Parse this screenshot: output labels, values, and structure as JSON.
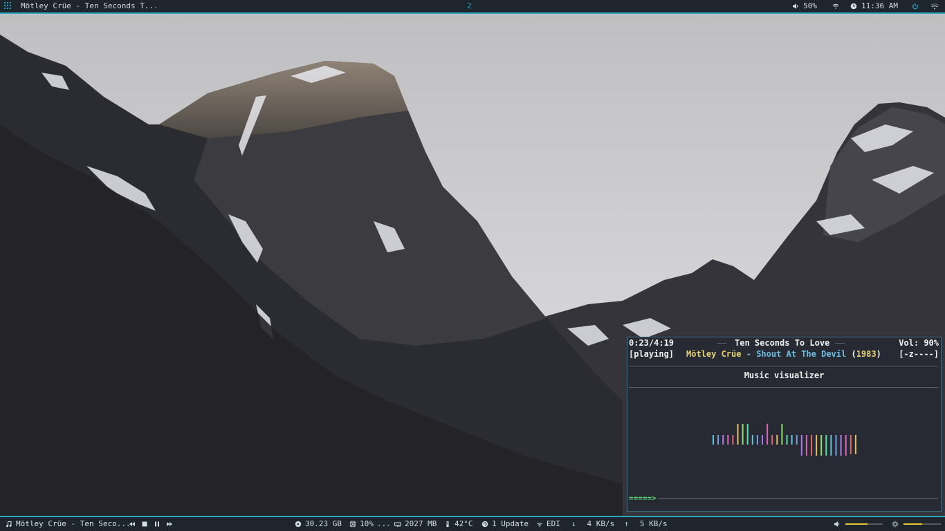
{
  "topbar": {
    "window_title": "Mötley Crüe - Ten Seconds T...",
    "workspace": "2",
    "volume": "50%",
    "time": "11:36 AM",
    "accent": "#2aa7c1",
    "icons": [
      "apps-grid-icon",
      "speaker-icon",
      "wifi-icon",
      "clock-icon",
      "power-icon",
      "wifi-signal-icon"
    ]
  },
  "player": {
    "elapsed_total": "0:23/4:19",
    "status": "[playing]",
    "title": "Ten Seconds To Love",
    "artist": "Mötley Crüe",
    "separator": "-",
    "album": "Shout At The Devil",
    "year_open": "(",
    "year": "1983",
    "year_close": ")",
    "volume": "Vol: 90%",
    "flags": "[-z----]",
    "screen_title": "Music visualizer",
    "progress_text": "=====>"
  },
  "bottombar": {
    "now_playing": "Mötley Crüe - Ten Seco...",
    "disk": "30.23 GB",
    "cpu": "10%",
    "cpu_more": "...",
    "memory": "2027 MB",
    "temperature": "42°C",
    "updates": "1 Update",
    "network_name": "EDI",
    "down_arrow": "↓",
    "download": "4 KB/s",
    "up_arrow": "↑",
    "upload": "5 KB/s",
    "volume_level": 0.6,
    "brightness_level": 0.5,
    "icons": [
      "music-note-icon",
      "previous-icon",
      "stop-icon",
      "pause-icon",
      "next-icon",
      "disk-icon",
      "cpu-icon",
      "memory-icon",
      "temperature-icon",
      "update-icon",
      "wifi-icon",
      "volume-icon",
      "brightness-icon"
    ]
  }
}
